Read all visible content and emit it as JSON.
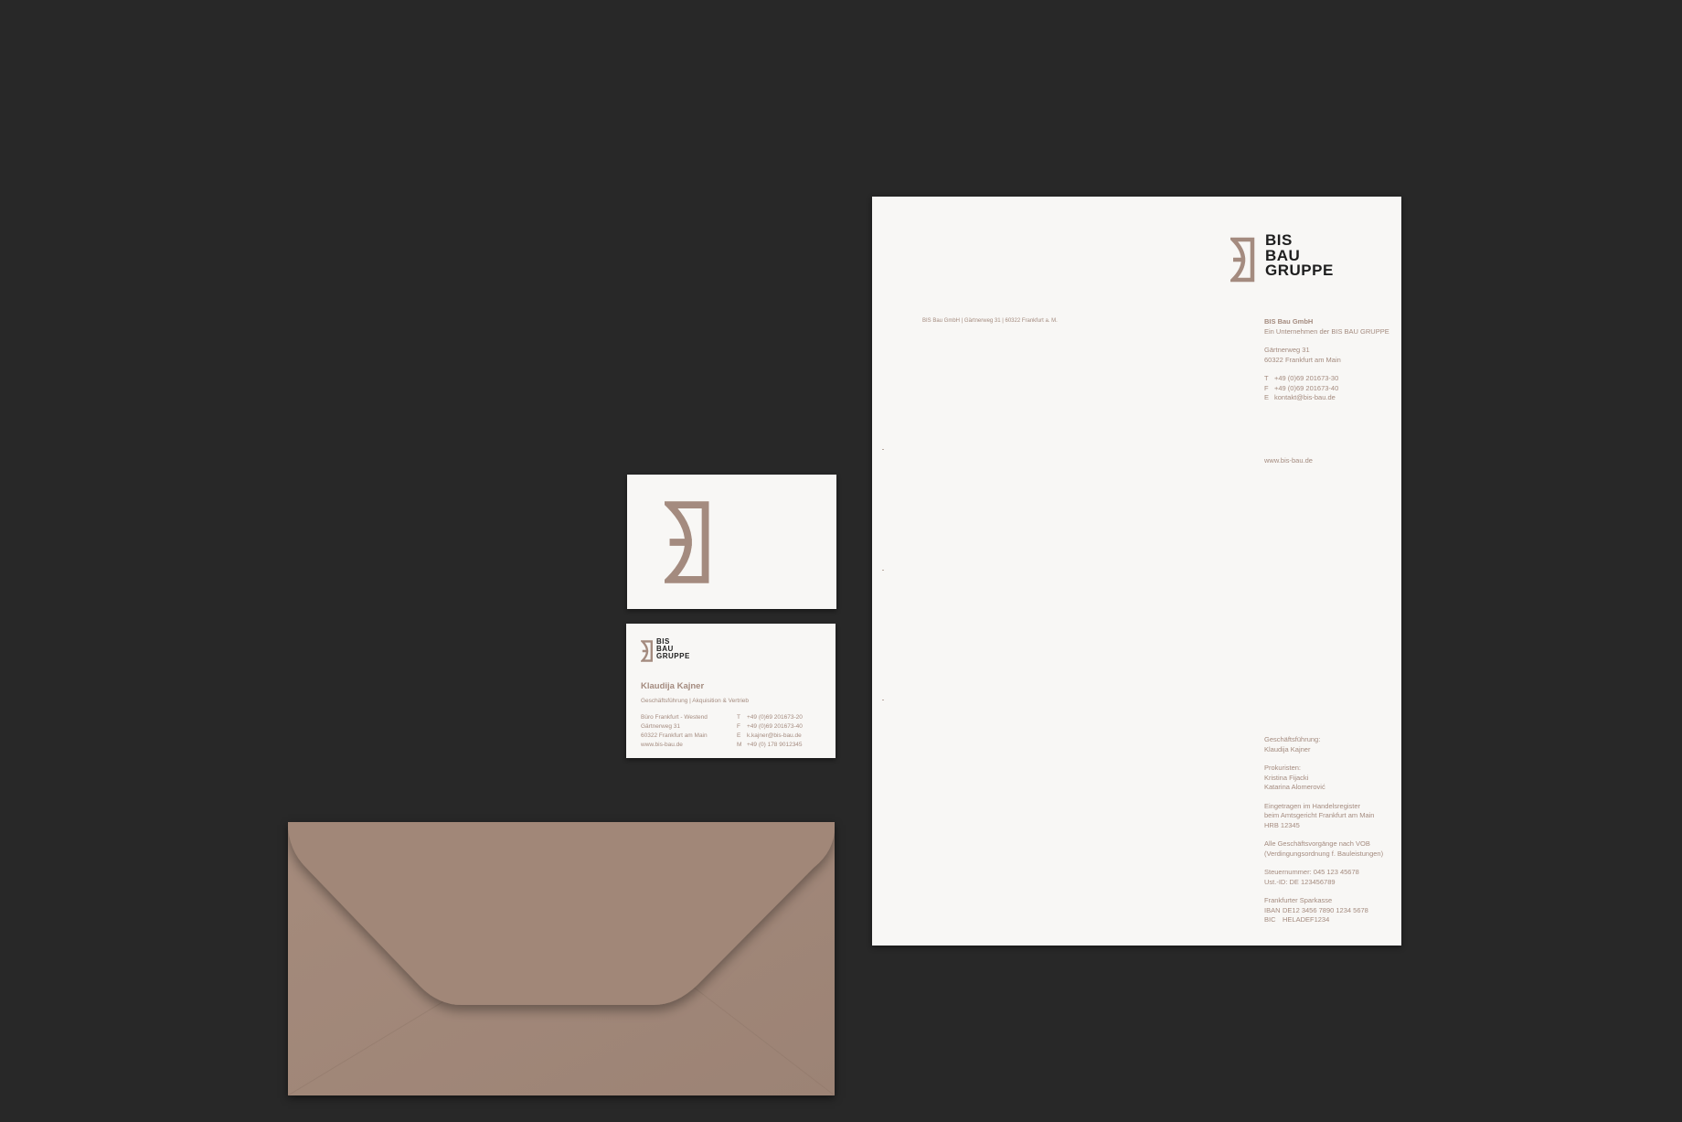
{
  "colors": {
    "background": "#282828",
    "paper": "#f8f7f5",
    "brand_tan": "#a48b7f",
    "envelope": "#a18778",
    "logo_text": "#1e1e1e"
  },
  "brand": {
    "logo_lines": [
      "BIS",
      "BAU",
      "GRUPPE"
    ]
  },
  "letterhead": {
    "sender_line": "BIS Bau GmbH | Gärtnerweg 31 | 60322 Frankfurt a. M.",
    "company_name": "BIS Bau GmbH",
    "company_sub": "Ein Unternehmen der BIS BAU GRUPPE",
    "street": "Gärtnerweg 31",
    "city": "60322 Frankfurt am Main",
    "contacts": [
      {
        "key": "T",
        "value": "+49 (0)69 201673-30"
      },
      {
        "key": "F",
        "value": "+49 (0)69 201673-40"
      },
      {
        "key": "E",
        "value": "kontakt@bis-bau.de"
      }
    ],
    "web": "www.bis-bau.de",
    "footer": {
      "md_label": "Geschäftsführung:",
      "md_name": "Klaudija Kajner",
      "prok_label": "Prokuristen:",
      "prok_1": "Kristina Fijacki",
      "prok_2": "Katarina Alomerović",
      "reg_1": "Eingetragen im Handelsregister",
      "reg_2": "beim Amtsgericht Frankfurt am Main",
      "reg_3": "HRB 12345",
      "vob_1": "Alle Geschäftsvorgänge nach VOB",
      "vob_2": "(Verdingungsordnung f. Bauleistungen)",
      "tax_1": "Steuernummer: 045 123 45678",
      "tax_2": "Ust.-ID: DE 123456789",
      "bank": "Frankfurter Sparkasse",
      "iban": [
        {
          "key": "IBAN",
          "value": "DE12 3456 7890 1234 5678"
        },
        {
          "key": "BIC",
          "value": "HELADEF1234"
        }
      ]
    }
  },
  "business_card": {
    "name": "Klaudija Kajner",
    "role": "Geschäftsführung | Akquisition & Vertrieb",
    "address": [
      "Büro Frankfurt - Westend",
      "Gärtnerweg 31",
      "60322 Frankfurt am Main",
      "www.bis-bau.de"
    ],
    "contacts": [
      {
        "key": "T",
        "value": "+49 (0)69 201673-20"
      },
      {
        "key": "F",
        "value": "+49 (0)69 201673-40"
      },
      {
        "key": "E",
        "value": "k.kajner@bis-bau.de"
      },
      {
        "key": "M",
        "value": "+49 (0) 178 9012345"
      }
    ]
  }
}
